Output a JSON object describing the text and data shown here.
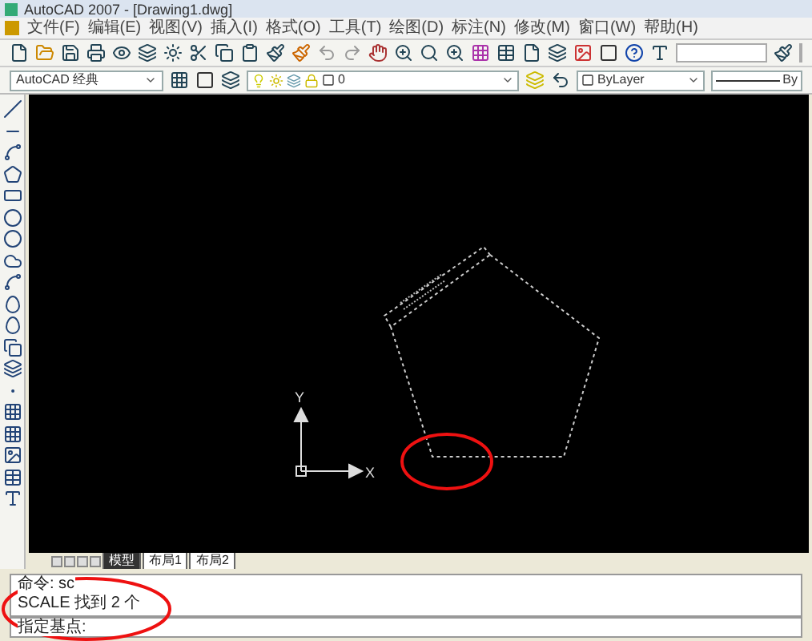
{
  "window": {
    "title": "AutoCAD 2007 - [Drawing1.dwg]"
  },
  "menu": [
    "文件(F)",
    "编辑(E)",
    "视图(V)",
    "插入(I)",
    "格式(O)",
    "工具(T)",
    "绘图(D)",
    "标注(N)",
    "修改(M)",
    "窗口(W)",
    "帮助(H)"
  ],
  "workspace": {
    "value": "AutoCAD 经典"
  },
  "layer": {
    "value": "0"
  },
  "color_control": {
    "value": "ByLayer"
  },
  "linetype_control": {
    "value": "By"
  },
  "layout_tabs": [
    {
      "label": "模型",
      "selected": true
    },
    {
      "label": "布局1",
      "selected": false
    },
    {
      "label": "布局2",
      "selected": false
    }
  ],
  "command_lines": [
    "命令: sc",
    "SCALE 找到 2 个"
  ],
  "command_prompt": "指定基点:",
  "ucs": {
    "y_label": "Y",
    "x_label": "X"
  }
}
